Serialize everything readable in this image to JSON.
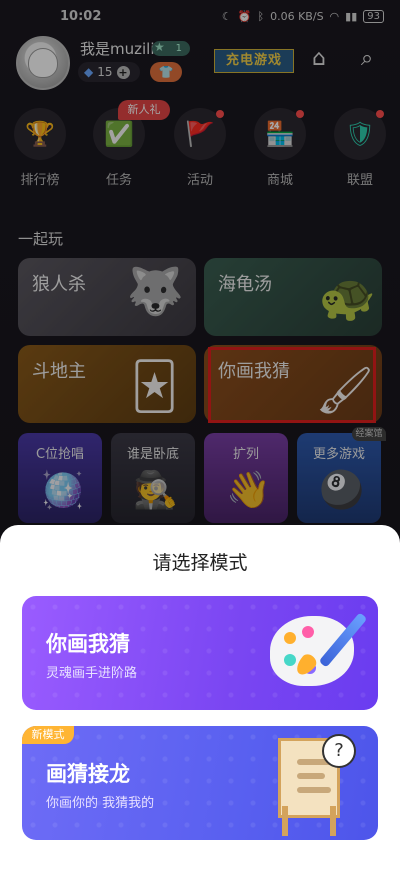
{
  "status_bar": {
    "time": "10:02",
    "net_speed": "0.06 KB/S",
    "battery": "93"
  },
  "profile": {
    "username": "我是muzili",
    "level": "1",
    "gems": "15",
    "charge_banner": "充电游戏"
  },
  "nav": [
    {
      "label": "排行榜",
      "icon": "trophy-icon"
    },
    {
      "label": "任务",
      "icon": "task-check-icon",
      "tag": "新人礼"
    },
    {
      "label": "活动",
      "icon": "flag-icon"
    },
    {
      "label": "商城",
      "icon": "shop-icon"
    },
    {
      "label": "联盟",
      "icon": "shield-icon"
    }
  ],
  "section": {
    "title": "一起玩"
  },
  "games": [
    {
      "title": "狼人杀"
    },
    {
      "title": "海龟汤"
    },
    {
      "title": "斗地主"
    },
    {
      "title": "你画我猜"
    }
  ],
  "small_games": [
    {
      "title": "C位抢唱"
    },
    {
      "title": "谁是卧底"
    },
    {
      "title": "扩列"
    },
    {
      "title": "更多游戏"
    }
  ],
  "corner_tag": "经案馆",
  "sheet": {
    "title": "请选择模式",
    "modes": [
      {
        "title": "你画我猜",
        "subtitle": "灵魂画手进阶路"
      },
      {
        "title": "画猜接龙",
        "subtitle": "你画你的 我猜我的",
        "badge": "新模式"
      }
    ]
  },
  "colors": {
    "accent_red": "#e0201e",
    "mode1": "#8a52f8",
    "mode2": "#5960f0"
  }
}
